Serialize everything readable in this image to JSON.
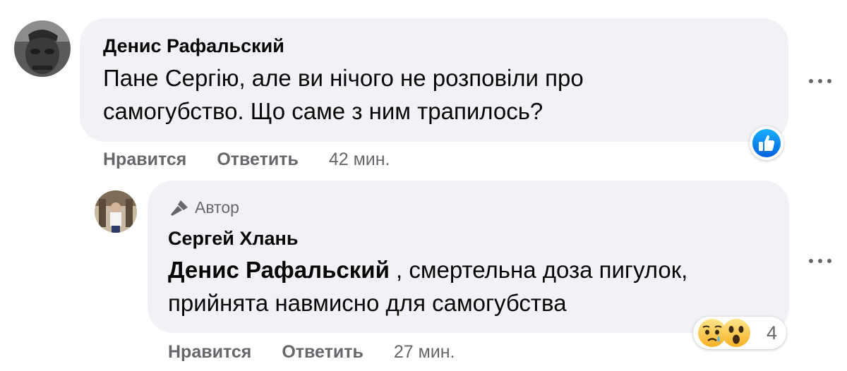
{
  "comment": {
    "author": "Денис Рафальский",
    "text_line1": "Пане Сергію, але ви нічого не розповіли про",
    "text_line2": "самогубство. Що саме з ним трапилось?",
    "like_label": "Нравится",
    "reply_label": "Ответить",
    "time": "42 мин.",
    "reaction_icon": "like-icon"
  },
  "reply": {
    "badge_label": "Автор",
    "author": "Сергей Хлань",
    "mention": "Денис Рафальский",
    "text_line1_rest": " , смертельна доза пигулок,",
    "text_line2": "прийнята навмисно для самогубства",
    "like_label": "Нравится",
    "reply_label": "Ответить",
    "time": "27 мин.",
    "reaction_icons": [
      "sad-icon",
      "wow-icon"
    ],
    "reaction_count": "4"
  },
  "colors": {
    "bubble": "#f0f2f5",
    "text": "#050505",
    "muted": "#65676b",
    "like_blue": "#1877f2"
  }
}
